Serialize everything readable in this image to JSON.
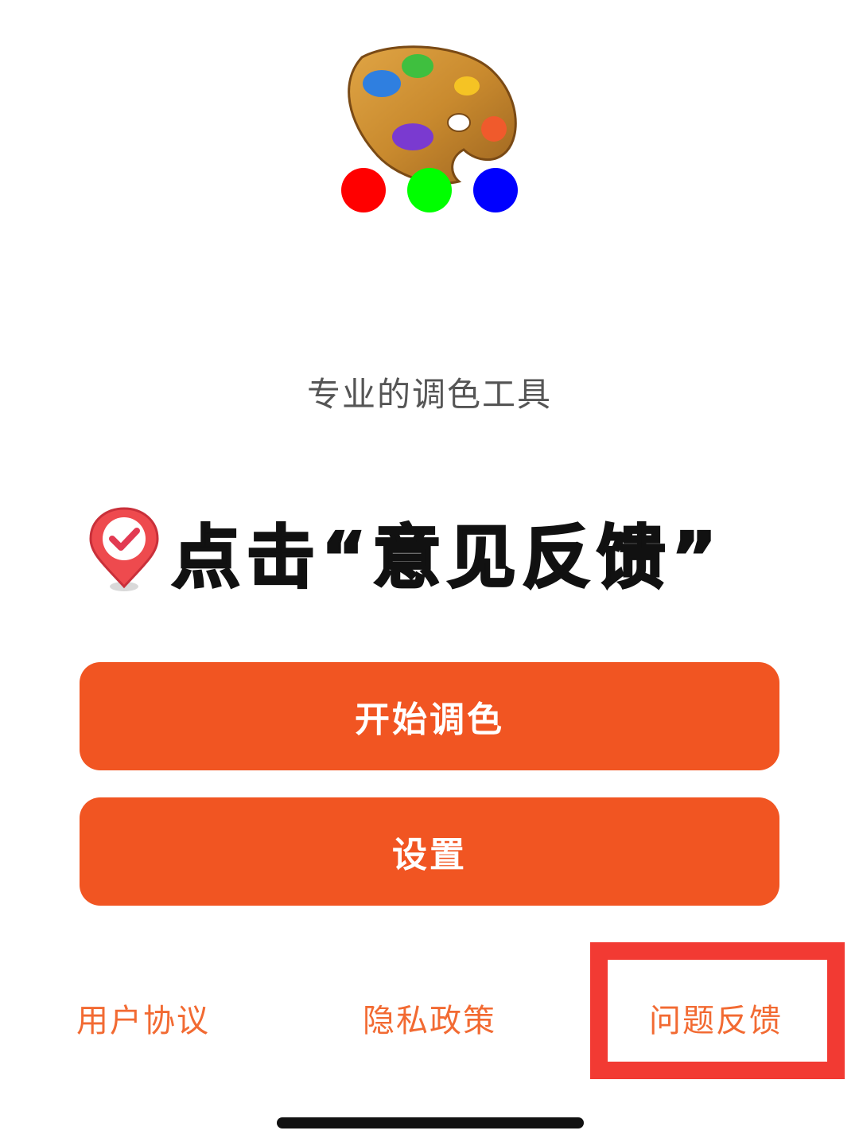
{
  "app": {
    "subtitle": "专业的调色工具"
  },
  "annotation": {
    "text": "点击“意见反馈”",
    "icon": "check-pin-icon"
  },
  "buttons": {
    "start_label": "开始调色",
    "settings_label": "设置"
  },
  "footer": {
    "terms_label": "用户协议",
    "privacy_label": "隐私政策",
    "feedback_label": "问题反馈"
  },
  "colors": {
    "accent": "#f15522",
    "link": "#f26a32",
    "highlight": "#f23a33",
    "dot_red": "#ff0000",
    "dot_green": "#00ff00",
    "dot_blue": "#0000ff"
  }
}
